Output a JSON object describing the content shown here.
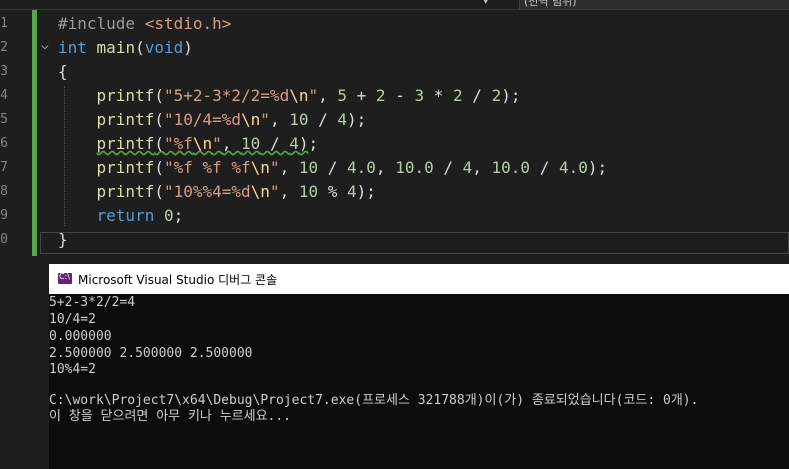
{
  "editor": {
    "scope_label": "(전역 범위)",
    "scope_dropdown": "▾",
    "line_numbers": [
      "1",
      "2",
      "3",
      "4",
      "5",
      "6",
      "7",
      "8",
      "9",
      "0"
    ],
    "fold_marker": "⌵",
    "lines": [
      {
        "tokens": [
          {
            "c": "pp",
            "t": "#include "
          },
          {
            "c": "hdr",
            "t": "<stdio.h>"
          }
        ]
      },
      {
        "tokens": [
          {
            "c": "kw",
            "t": "int"
          },
          {
            "c": "",
            "t": " "
          },
          {
            "c": "fn",
            "t": "main"
          },
          {
            "c": "",
            "t": "("
          },
          {
            "c": "kw",
            "t": "void"
          },
          {
            "c": "",
            "t": ")"
          }
        ]
      },
      {
        "tokens": [
          {
            "c": "",
            "t": "{"
          }
        ]
      },
      {
        "tokens": [
          {
            "c": "",
            "t": "    "
          },
          {
            "c": "fn",
            "t": "printf"
          },
          {
            "c": "",
            "t": "("
          },
          {
            "c": "str",
            "t": "\"5+2-3*2/2=%d"
          },
          {
            "c": "esc",
            "t": "\\n"
          },
          {
            "c": "str",
            "t": "\""
          },
          {
            "c": "",
            "t": ", "
          },
          {
            "c": "num",
            "t": "5"
          },
          {
            "c": "",
            "t": " + "
          },
          {
            "c": "num",
            "t": "2"
          },
          {
            "c": "",
            "t": " - "
          },
          {
            "c": "num",
            "t": "3"
          },
          {
            "c": "",
            "t": " * "
          },
          {
            "c": "num",
            "t": "2"
          },
          {
            "c": "",
            "t": " / "
          },
          {
            "c": "num",
            "t": "2"
          },
          {
            "c": "",
            "t": ");"
          }
        ]
      },
      {
        "tokens": [
          {
            "c": "",
            "t": "    "
          },
          {
            "c": "fn",
            "t": "printf"
          },
          {
            "c": "",
            "t": "("
          },
          {
            "c": "str",
            "t": "\"10/4=%d"
          },
          {
            "c": "esc",
            "t": "\\n"
          },
          {
            "c": "str",
            "t": "\""
          },
          {
            "c": "",
            "t": ", "
          },
          {
            "c": "num",
            "t": "10"
          },
          {
            "c": "",
            "t": " / "
          },
          {
            "c": "num",
            "t": "4"
          },
          {
            "c": "",
            "t": ");"
          }
        ]
      },
      {
        "tokens": [
          {
            "c": "",
            "t": "    "
          },
          {
            "c": "fn squiggle",
            "t": "printf"
          },
          {
            "c": "squiggle",
            "t": "("
          },
          {
            "c": "str squiggle",
            "t": "\"%f"
          },
          {
            "c": "esc squiggle",
            "t": "\\n"
          },
          {
            "c": "str squiggle",
            "t": "\""
          },
          {
            "c": "squiggle",
            "t": ", "
          },
          {
            "c": "num squiggle",
            "t": "10"
          },
          {
            "c": "squiggle",
            "t": " / "
          },
          {
            "c": "num squiggle",
            "t": "4"
          },
          {
            "c": "squiggle",
            "t": ")"
          },
          {
            "c": "",
            "t": ";"
          }
        ]
      },
      {
        "tokens": [
          {
            "c": "",
            "t": "    "
          },
          {
            "c": "fn",
            "t": "printf"
          },
          {
            "c": "",
            "t": "("
          },
          {
            "c": "str",
            "t": "\"%f %f %f"
          },
          {
            "c": "esc",
            "t": "\\n"
          },
          {
            "c": "str",
            "t": "\""
          },
          {
            "c": "",
            "t": ", "
          },
          {
            "c": "num",
            "t": "10"
          },
          {
            "c": "",
            "t": " / "
          },
          {
            "c": "num",
            "t": "4.0"
          },
          {
            "c": "",
            "t": ", "
          },
          {
            "c": "num",
            "t": "10.0"
          },
          {
            "c": "",
            "t": " / "
          },
          {
            "c": "num",
            "t": "4"
          },
          {
            "c": "",
            "t": ", "
          },
          {
            "c": "num",
            "t": "10.0"
          },
          {
            "c": "",
            "t": " / "
          },
          {
            "c": "num",
            "t": "4.0"
          },
          {
            "c": "",
            "t": ");"
          }
        ]
      },
      {
        "tokens": [
          {
            "c": "",
            "t": "    "
          },
          {
            "c": "fn",
            "t": "printf"
          },
          {
            "c": "",
            "t": "("
          },
          {
            "c": "str",
            "t": "\"10%%4=%d"
          },
          {
            "c": "esc",
            "t": "\\n"
          },
          {
            "c": "str",
            "t": "\""
          },
          {
            "c": "",
            "t": ", "
          },
          {
            "c": "num",
            "t": "10"
          },
          {
            "c": "",
            "t": " % "
          },
          {
            "c": "num",
            "t": "4"
          },
          {
            "c": "",
            "t": ");"
          }
        ]
      },
      {
        "tokens": [
          {
            "c": "",
            "t": "    "
          },
          {
            "c": "kw",
            "t": "return"
          },
          {
            "c": "",
            "t": " "
          },
          {
            "c": "num",
            "t": "0"
          },
          {
            "c": "",
            "t": ";"
          }
        ]
      },
      {
        "tokens": [
          {
            "c": "bracket",
            "t": "}"
          }
        ]
      }
    ]
  },
  "console": {
    "title": "Microsoft Visual Studio 디버그 콘솔",
    "icon_text": "C:\\",
    "lines": [
      "5+2-3*2/2=4",
      "10/4=2",
      "0.000000",
      "2.500000 2.500000 2.500000",
      "10%4=2",
      "",
      "C:\\work\\Project7\\x64\\Debug\\Project7.exe(프로세스 321788개)이(가) 종료되었습니다(코드: 0개).",
      "이 창을 닫으려면 아무 키나 누르세요..."
    ]
  }
}
